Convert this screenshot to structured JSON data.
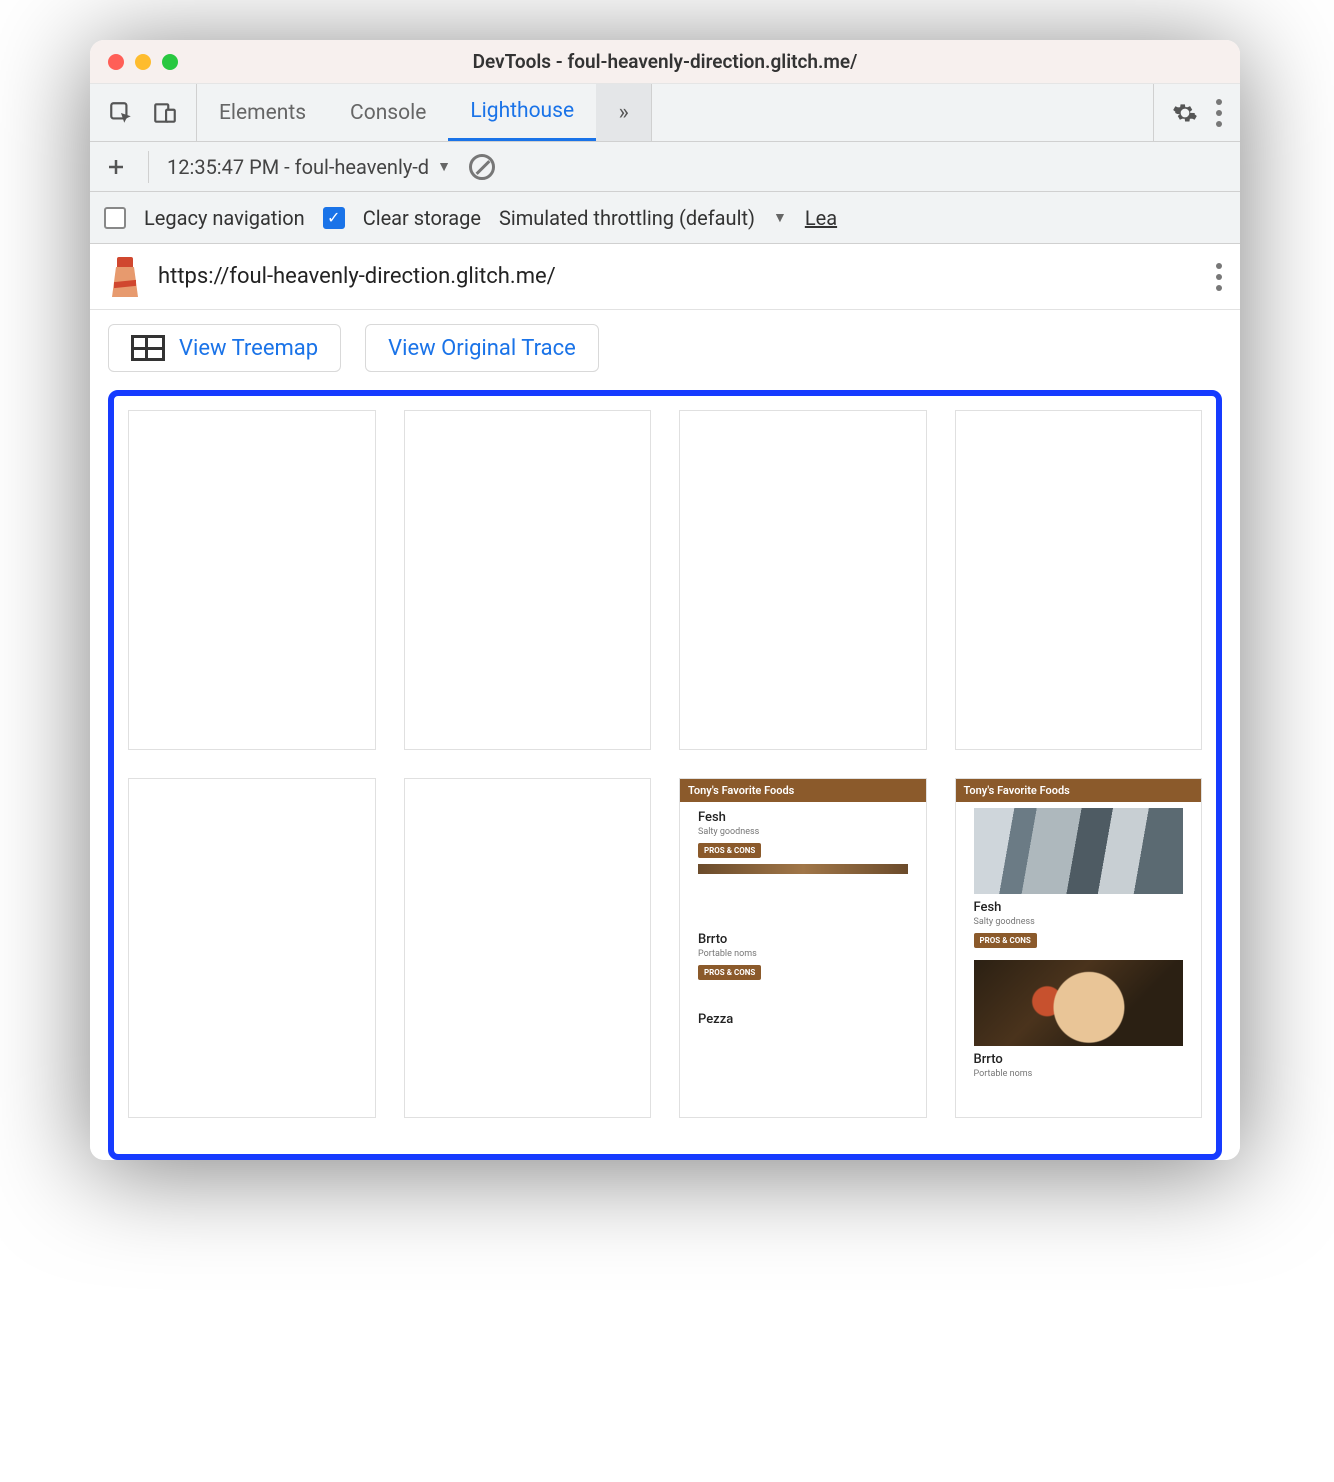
{
  "window": {
    "title": "DevTools - foul-heavenly-direction.glitch.me/"
  },
  "tabs": {
    "elements": "Elements",
    "console": "Console",
    "lighthouse": "Lighthouse",
    "more": "»"
  },
  "reportbar": {
    "selected": "12:35:47 PM - foul-heavenly-d"
  },
  "options": {
    "legacy_label": "Legacy navigation",
    "clear_label": "Clear storage",
    "throttling_label": "Simulated throttling (default)",
    "learn_label": "Lea"
  },
  "urlbar": {
    "url": "https://foul-heavenly-direction.glitch.me/"
  },
  "buttons": {
    "view_treemap": "View Treemap",
    "view_trace": "View Original Trace"
  },
  "mini": {
    "header": "Tony's Favorite Foods",
    "items": [
      {
        "title": "Fesh",
        "sub": "Salty goodness",
        "btn": "PROS & CONS"
      },
      {
        "title": "Brrto",
        "sub": "Portable noms",
        "btn": "PROS & CONS"
      },
      {
        "title": "Pezza",
        "sub": "",
        "btn": ""
      }
    ]
  }
}
